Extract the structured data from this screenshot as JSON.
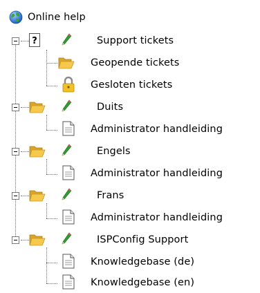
{
  "tree": {
    "root": {
      "label": "Online help",
      "icon": "globe-icon"
    },
    "groups": [
      {
        "label": "Support tickets",
        "icon": "help-folder-icon",
        "children": [
          {
            "label": "Geopende tickets",
            "icon": "open-folder-icon"
          },
          {
            "label": "Gesloten tickets",
            "icon": "lock-icon"
          }
        ]
      },
      {
        "label": "Duits",
        "icon": "folder-icon",
        "children": [
          {
            "label": "Administrator handleiding",
            "icon": "document-icon"
          }
        ]
      },
      {
        "label": "Engels",
        "icon": "folder-icon",
        "children": [
          {
            "label": "Administrator handleiding",
            "icon": "document-icon"
          }
        ]
      },
      {
        "label": "Frans",
        "icon": "folder-icon",
        "children": [
          {
            "label": "Administrator handleiding",
            "icon": "document-icon"
          }
        ]
      },
      {
        "label": "ISPConfig Support",
        "icon": "folder-icon",
        "children": [
          {
            "label": "Knowledgebase (de)",
            "icon": "document-icon"
          },
          {
            "label": "Knowledgebase (en)",
            "icon": "document-icon"
          }
        ]
      }
    ]
  },
  "colors": {
    "folder": "#f6c84c",
    "folder_dark": "#c9941c",
    "pencil": "#2f9e2f",
    "globe_blue": "#2a6fd6",
    "globe_green": "#3aa33a"
  }
}
